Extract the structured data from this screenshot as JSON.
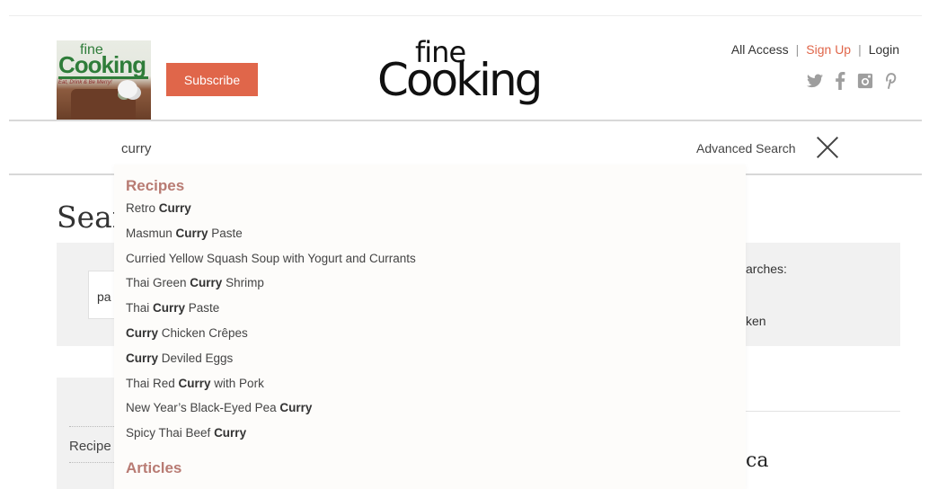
{
  "header": {
    "subscribe_label": "Subscribe",
    "logo_fine": "fine",
    "logo_cooking": "Cooking",
    "magazine": {
      "logo_fine": "fine",
      "logo_cooking": "Cooking",
      "tagline": "Eat, Drink & Be Merry!"
    },
    "account": {
      "all_access": "All Access",
      "sep1": "|",
      "sign_up": "Sign Up",
      "sep2": "|",
      "login": "Login"
    },
    "social": [
      "twitter-icon",
      "facebook-icon",
      "instagram-icon",
      "pinterest-icon"
    ]
  },
  "search": {
    "value": "curry",
    "advanced_label": "Advanced Search"
  },
  "page": {
    "title_fragment": "Sear",
    "input_fragment": "pa",
    "recent_label_fragment": "arches:",
    "recent_item_fragment": "ken",
    "filter_recipes_fragment": "Recipe",
    "result_fragment": "ca"
  },
  "autocomplete": {
    "recipes_heading": "Recipes",
    "articles_heading": "Articles",
    "items": [
      {
        "pre": "Retro ",
        "match": "Curry",
        "post": ""
      },
      {
        "pre": "Masmun ",
        "match": "Curry",
        "post": " Paste"
      },
      {
        "pre": "Curried Yellow Squash Soup with Yogurt and Currants",
        "match": "",
        "post": ""
      },
      {
        "pre": "Thai Green ",
        "match": "Curry",
        "post": " Shrimp"
      },
      {
        "pre": "Thai ",
        "match": "Curry",
        "post": " Paste"
      },
      {
        "pre": "",
        "match": "Curry",
        "post": " Chicken Crêpes"
      },
      {
        "pre": "",
        "match": "Curry",
        "post": " Deviled Eggs"
      },
      {
        "pre": "Thai Red ",
        "match": "Curry",
        "post": " with Pork"
      },
      {
        "pre": "New Year’s Black-Eyed Pea ",
        "match": "Curry",
        "post": ""
      },
      {
        "pre": "Spicy Thai Beef ",
        "match": "Curry",
        "post": ""
      }
    ]
  },
  "colors": {
    "accent": "#e0664a",
    "heading": "#b87b73",
    "icon_grey": "#9e9e9e"
  }
}
